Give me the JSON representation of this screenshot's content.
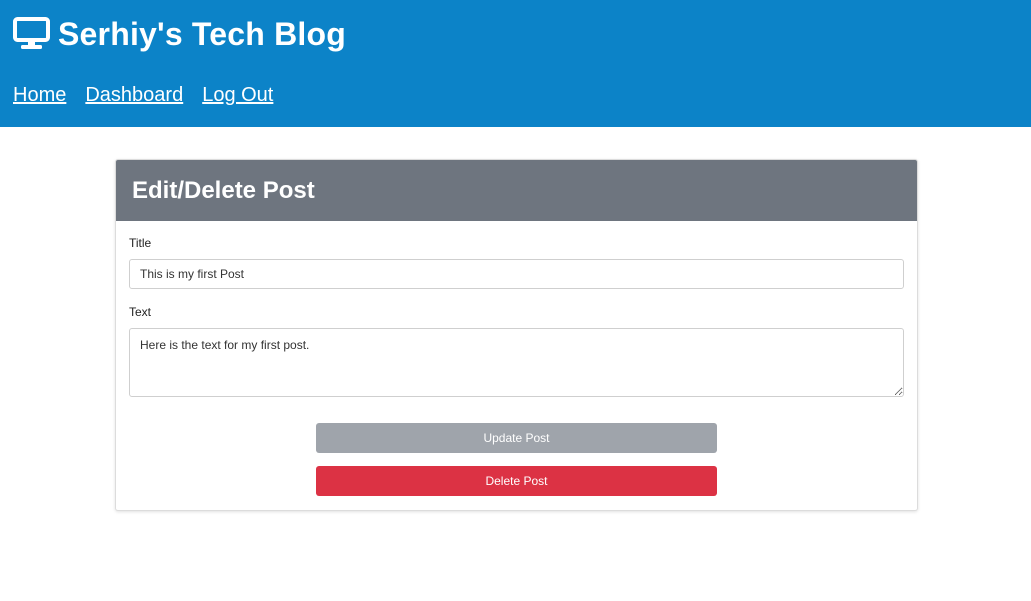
{
  "header": {
    "brand_icon": "monitor-icon",
    "title": "Serhiy's Tech Blog",
    "nav": [
      {
        "label": "Home"
      },
      {
        "label": "Dashboard"
      },
      {
        "label": "Log Out"
      }
    ],
    "background_color": "#0c83c8"
  },
  "card": {
    "title": "Edit/Delete Post",
    "header_color": "#6e757f",
    "title_label": "Title",
    "title_value": "This is my first Post",
    "text_label": "Text",
    "text_value": "Here is the text for my first post.",
    "update_label": "Update Post",
    "delete_label": "Delete Post",
    "update_color": "#9fa4ab",
    "delete_color": "#dc3244"
  }
}
